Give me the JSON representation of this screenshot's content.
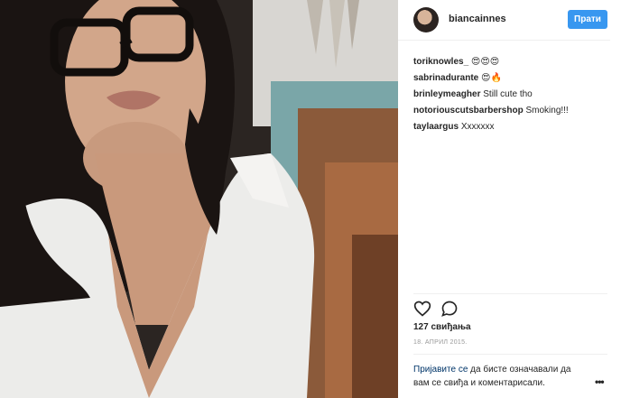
{
  "header": {
    "username": "biancainnes",
    "follow_label": "Прати"
  },
  "comments": [
    {
      "author": "toriknowles_",
      "text": "😍😍😍"
    },
    {
      "author": "sabrinadurante",
      "text": "😍🔥"
    },
    {
      "author": "brinleymeagher",
      "text": "Still cute tho"
    },
    {
      "author": "notoriouscutsbarbershop",
      "text": "Smoking!!!"
    },
    {
      "author": "taylaargus",
      "text": "Xxxxxxx"
    }
  ],
  "actions": {
    "like_icon": "heart-outline",
    "comment_icon": "speech-bubble-outline"
  },
  "likes": "127 свиђања",
  "date": "18. АПРИЛ 2015.",
  "login_prompt": {
    "link": "Пријавите се",
    "text": " да бисте означавали да вам се свиђа и коментарисали."
  },
  "more_icon": "•••"
}
